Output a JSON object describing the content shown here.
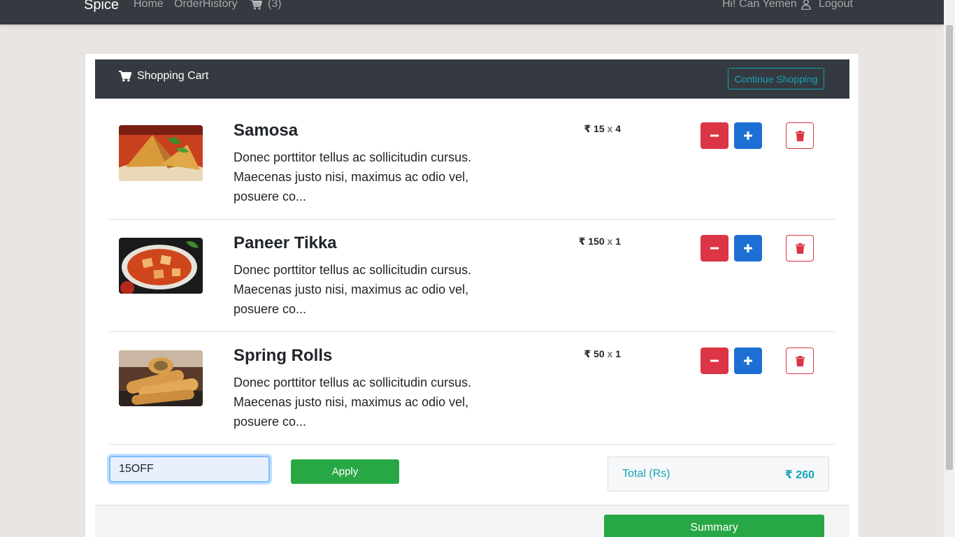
{
  "nav": {
    "brand": "Spice",
    "home": "Home",
    "order_history": "OrderHistory",
    "cart_count": "(3)",
    "greeting": "Hi! Can Yemen",
    "logout": "Logout"
  },
  "cart": {
    "title": "Shopping Cart",
    "continue_label": "Continue Shopping",
    "items": [
      {
        "name": "Samosa",
        "description": "Donec porttitor tellus ac sollicitudin cursus. Maecenas justo nisi, maximus ac odio vel, posuere co...",
        "price": "₹ 15",
        "qty": "4"
      },
      {
        "name": "Paneer Tikka",
        "description": "Donec porttitor tellus ac sollicitudin cursus. Maecenas justo nisi, maximus ac odio vel, posuere co...",
        "price": "₹ 150",
        "qty": "1"
      },
      {
        "name": "Spring Rolls",
        "description": "Donec porttitor tellus ac sollicitudin cursus. Maecenas justo nisi, maximus ac odio vel, posuere co...",
        "price": "₹ 50",
        "qty": "1"
      }
    ],
    "qty_separator": "x",
    "coupon_value": "15OFF",
    "apply_label": "Apply",
    "total_label": "Total (Rs)",
    "total_value": "₹ 260",
    "summary_label": "Summary"
  },
  "colors": {
    "navbar": "#343a40",
    "danger": "#dc3545",
    "primary": "#1e6fd4",
    "success": "#28a745",
    "info": "#17a2b8"
  }
}
